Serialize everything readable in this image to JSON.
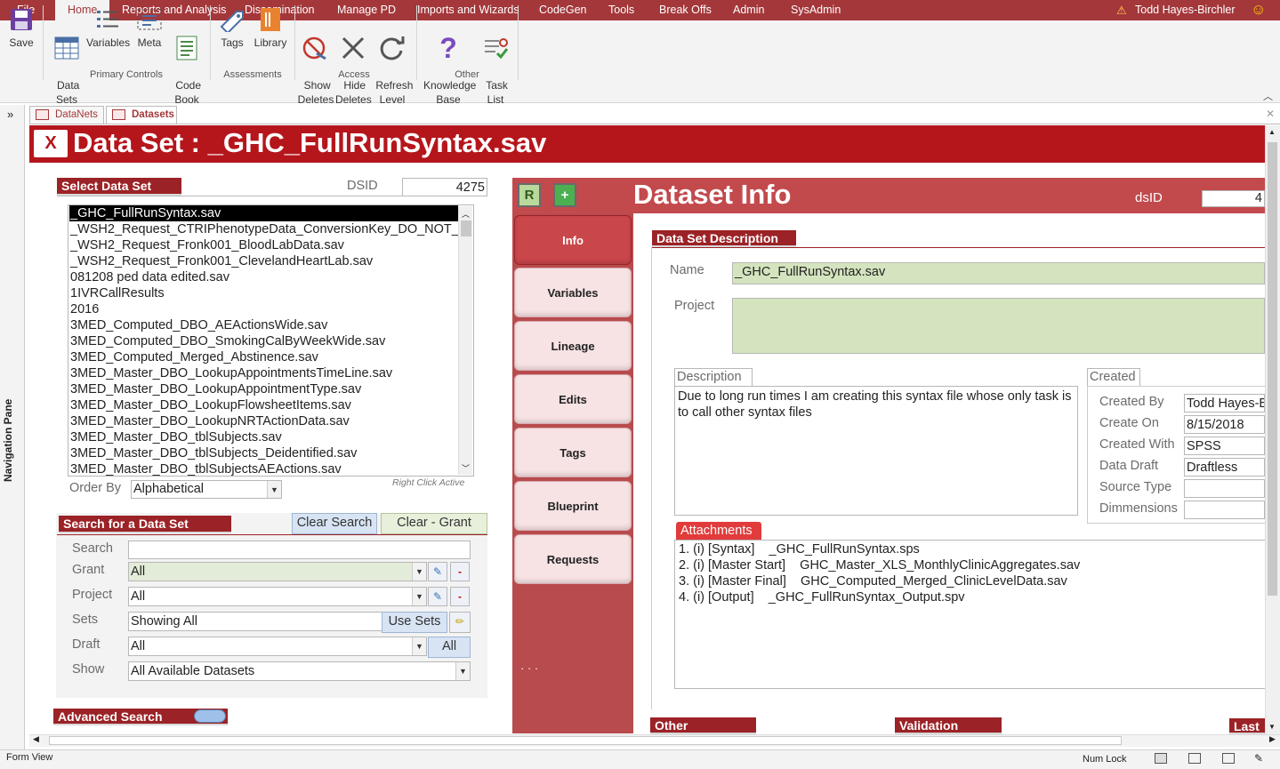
{
  "ribbon": {
    "tabs": [
      "File",
      "Home",
      "Reports and Analysis",
      "Dissemination",
      "Manage PD",
      "Imports and Wizards",
      "CodeGen",
      "Tools",
      "Break Offs",
      "Admin",
      "SysAdmin"
    ],
    "user": "Todd Hayes-Birchler",
    "buttons": {
      "save": "Save",
      "data_sets": "Data\nSets",
      "variables": "Variables",
      "meta": "Meta",
      "code_book": "Code\nBook",
      "tags": "Tags",
      "library": "Library",
      "show_deletes": "Show\nDeletes",
      "hide_deletes": "Hide\nDeletes",
      "refresh_level": "Refresh\nLevel",
      "knowledge_base": "Knowledge\nBase",
      "task_list": "Task\nList"
    },
    "groups": {
      "primary": "Primary Controls",
      "assessments": "Assessments",
      "access": "Access",
      "other": "Other"
    }
  },
  "nav": {
    "label": "Navigation Pane",
    "expand": "»"
  },
  "doc_tabs": [
    "DataNets",
    "Datasets"
  ],
  "header": {
    "close": "X",
    "title": "Data Set : _GHC_FullRunSyntax.sav"
  },
  "select": {
    "header": "Select Data Set",
    "dsid_label": "DSID",
    "dsid_value": "4275",
    "items": [
      "_GHC_FullRunSyntax.sav",
      "_WSH2_Request_CTRIPhenotypeData_ConversionKey_DO_NOT_",
      "_WSH2_Request_Fronk001_BloodLabData.sav",
      "_WSH2_Request_Fronk001_ClevelandHeartLab.sav",
      "081208 ped data edited.sav",
      "1IVRCallResults",
      "2016",
      "3MED_Computed_DBO_AEActionsWide.sav",
      "3MED_Computed_DBO_SmokingCalByWeekWide.sav",
      "3MED_Computed_Merged_Abstinence.sav",
      "3MED_Master_DBO_LookupAppointmentsTimeLine.sav",
      "3MED_Master_DBO_LookupAppointmentType.sav",
      "3MED_Master_DBO_LookupFlowsheetItems.sav",
      "3MED_Master_DBO_LookupNRTActionData.sav",
      "3MED_Master_DBO_tblSubjects.sav",
      "3MED_Master_DBO_tblSubjects_Deidentified.sav",
      "3MED_Master_DBO_tblSubjectsAEActions.sav"
    ],
    "order_label": "Order By",
    "order_value": "Alphabetical",
    "right_click": "Right Click Active"
  },
  "search": {
    "header": "Search for a Data Set",
    "clear_search": "Clear Search",
    "clear_grant": "Clear - Grant",
    "search_label": "Search",
    "search_value": "",
    "grant_label": "Grant",
    "grant_value": "All",
    "project_label": "Project",
    "project_value": "All",
    "sets_label": "Sets",
    "sets_value": "Showing All",
    "use_sets": "Use Sets",
    "draft_label": "Draft",
    "draft_value": "All",
    "draft_all": "All",
    "show_label": "Show",
    "show_value": "All Available Datasets"
  },
  "advanced": "Advanced Search",
  "info": {
    "title": "Dataset Info",
    "dsid_label": "dsID",
    "dsid_value": "4",
    "r_btn": "R",
    "plus_btn": "+",
    "tabs": [
      "Info",
      "Variables",
      "Lineage",
      "Edits",
      "Tags",
      "Blueprint",
      "Requests"
    ],
    "more": "· · ·",
    "desc_header": "Data Set Description",
    "name_label": "Name",
    "name_value": "_GHC_FullRunSyntax.sav",
    "project_label": "Project",
    "project_value": "",
    "description_label": "Description",
    "description_value": "Due to long run times I am creating this syntax file whose only task is to call other syntax files",
    "created_label": "Created",
    "created_by_label": "Created By",
    "created_by": "Todd Hayes-B",
    "create_on_label": "Create On",
    "create_on": "8/15/2018",
    "created_with_label": "Created With",
    "created_with": "SPSS",
    "data_draft_label": "Data Draft",
    "data_draft": "Draftless",
    "source_type_label": "Source Type",
    "source_type": "",
    "dimensions_label": "Dimmensions",
    "dimensions": "",
    "attachments_label": "Attachments",
    "attachments": [
      "1. (i) [Syntax]    _GHC_FullRunSyntax.sps",
      "2. (i) [Master Start]    GHC_Master_XLS_MonthlyClinicAggregates.sav",
      "3. (i) [Master Final]    GHC_Computed_Merged_ClinicLevelData.sav",
      "4. (i) [Output]    _GHC_FullRunSyntax_Output.spv"
    ],
    "other": "Other",
    "validation": "Validation",
    "last": "Last"
  },
  "status": {
    "left": "Form View",
    "num_lock": "Num Lock"
  },
  "colors": {
    "brand": "#a4373a",
    "header": "#b5161c",
    "field_green": "#d4e4be"
  }
}
